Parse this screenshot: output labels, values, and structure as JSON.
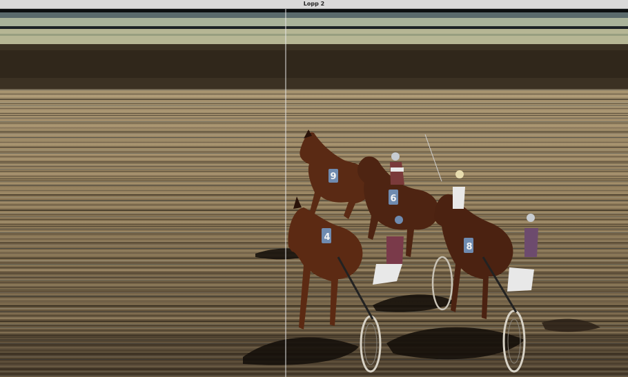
{
  "window": {
    "title": "Lopp 2"
  },
  "image": {
    "subject": "photo-finish",
    "horses": [
      {
        "number": "9"
      },
      {
        "number": "6"
      },
      {
        "number": "4"
      },
      {
        "number": "8"
      }
    ],
    "colors": {
      "track_light": "#9c8a6b",
      "track_dark": "#3a2f22",
      "sky_band": "#a9b39a",
      "finish_line": "#e6e6e6",
      "saddle_cloth": "#6f8bb0",
      "horse_brown": "#5a2a14"
    }
  }
}
